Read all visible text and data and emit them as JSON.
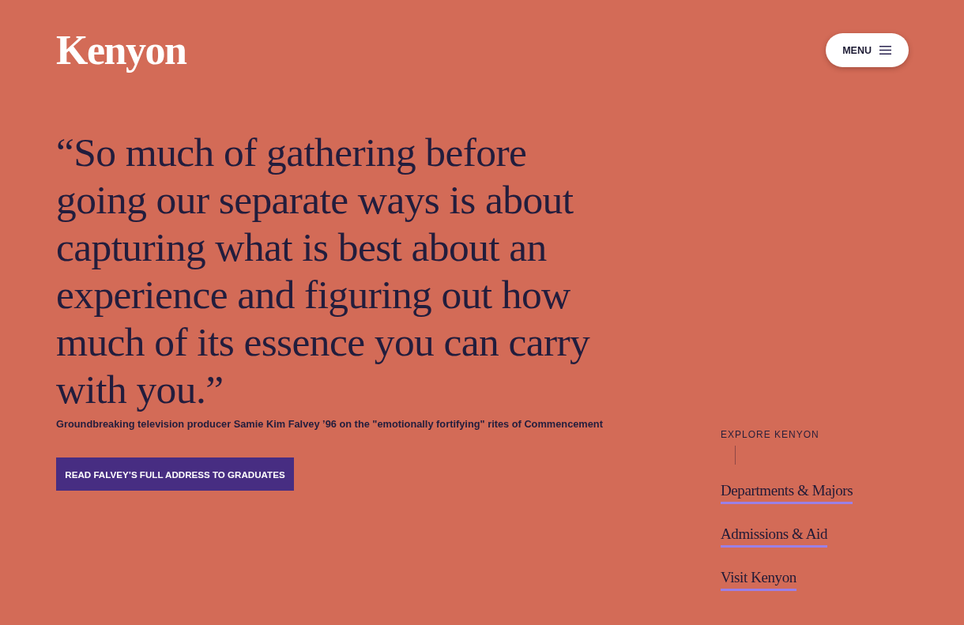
{
  "header": {
    "logo": "Kenyon",
    "menu_button": {
      "label": "MENU"
    }
  },
  "feature": {
    "quote": "“So much of gathering before going our separate ways is about capturing what is best about an experience and figuring out how much of its essence you can carry with you.”",
    "caption": "Groundbreaking television producer Samie Kim Falvey ’96 on the \"emotionally fortifying\" rites of Commencement",
    "button": "READ FALVEY’S FULL ADDRESS TO GRADUATES"
  },
  "explore": {
    "heading": "EXPLORE KENYON",
    "links": [
      "Departments & Majors",
      "Admissions & Aid",
      "Visit Kenyon"
    ]
  }
}
